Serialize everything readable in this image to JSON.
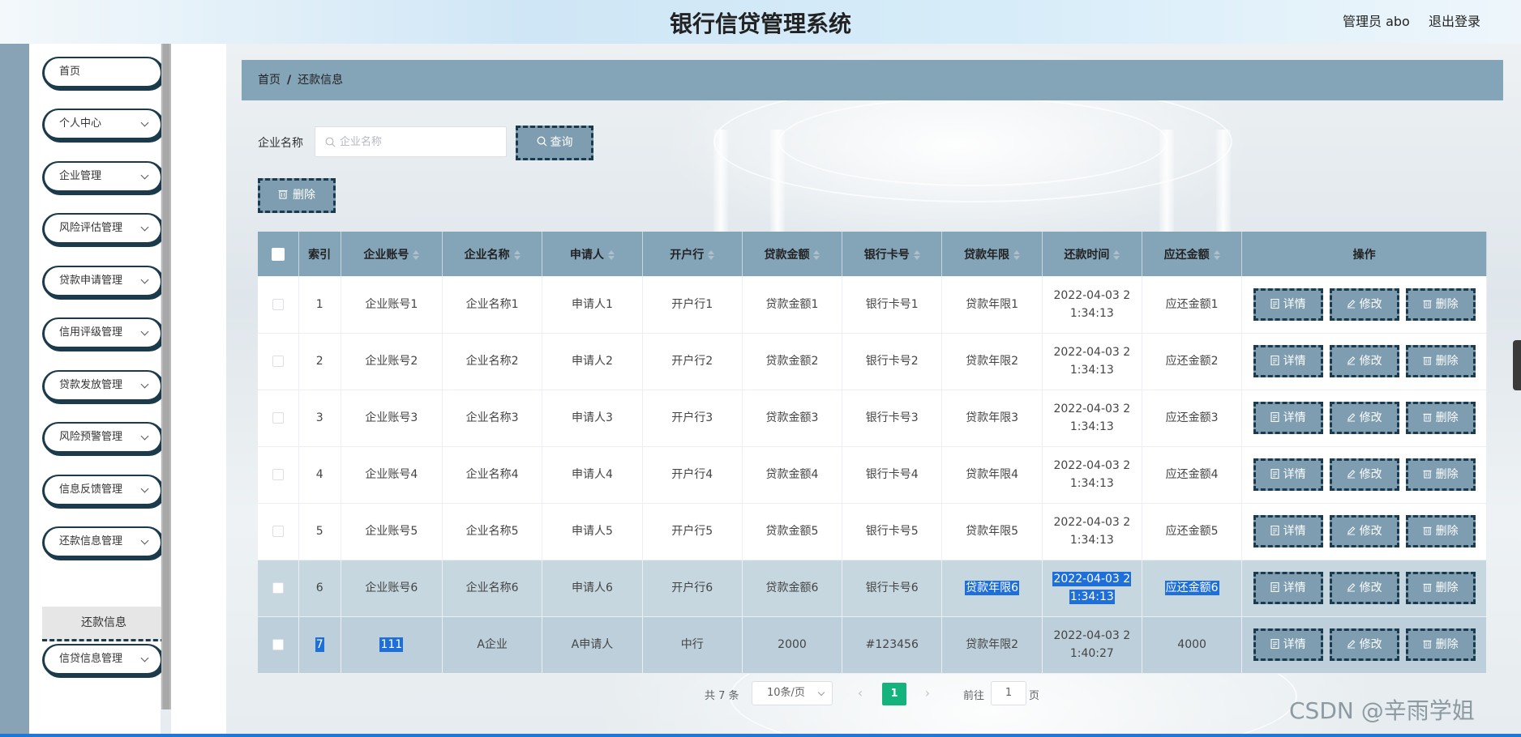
{
  "header": {
    "title": "银行信贷管理系统",
    "admin": "管理员 abo",
    "logout": "退出登录"
  },
  "sidebar": {
    "items": [
      {
        "label": "首页",
        "has_chevron": false
      },
      {
        "label": "个人中心",
        "has_chevron": true
      },
      {
        "label": "企业管理",
        "has_chevron": true
      },
      {
        "label": "风险评估管理",
        "has_chevron": true
      },
      {
        "label": "贷款申请管理",
        "has_chevron": true
      },
      {
        "label": "信用评级管理",
        "has_chevron": true
      },
      {
        "label": "贷款发放管理",
        "has_chevron": true
      },
      {
        "label": "风险预警管理",
        "has_chevron": true
      },
      {
        "label": "信息反馈管理",
        "has_chevron": true
      },
      {
        "label": "还款信息管理",
        "has_chevron": true
      },
      {
        "label": "信贷信息管理",
        "has_chevron": true
      }
    ],
    "active_sub": "还款信息"
  },
  "breadcrumb": {
    "home": "首页",
    "sep": "/",
    "current": "还款信息"
  },
  "search": {
    "label": "企业名称",
    "placeholder": "企业名称",
    "value": "",
    "query_button": "查询"
  },
  "toolbar": {
    "delete_button": "删除"
  },
  "table": {
    "columns": [
      "索引",
      "企业账号",
      "企业名称",
      "申请人",
      "开户行",
      "贷款金额",
      "银行卡号",
      "贷款年限",
      "还款时间",
      "应还金额",
      "操作"
    ],
    "rows": [
      {
        "idx": "1",
        "account": "企业账号1",
        "name": "企业名称1",
        "applicant": "申请人1",
        "bank": "开户行1",
        "amount": "贷款金额1",
        "card": "银行卡号1",
        "term": "贷款年限1",
        "time1": "2022-04-03 2",
        "time2": "1:34:13",
        "due": "应还金额1"
      },
      {
        "idx": "2",
        "account": "企业账号2",
        "name": "企业名称2",
        "applicant": "申请人2",
        "bank": "开户行2",
        "amount": "贷款金额2",
        "card": "银行卡号2",
        "term": "贷款年限2",
        "time1": "2022-04-03 2",
        "time2": "1:34:13",
        "due": "应还金额2"
      },
      {
        "idx": "3",
        "account": "企业账号3",
        "name": "企业名称3",
        "applicant": "申请人3",
        "bank": "开户行3",
        "amount": "贷款金额3",
        "card": "银行卡号3",
        "term": "贷款年限3",
        "time1": "2022-04-03 2",
        "time2": "1:34:13",
        "due": "应还金额3"
      },
      {
        "idx": "4",
        "account": "企业账号4",
        "name": "企业名称4",
        "applicant": "申请人4",
        "bank": "开户行4",
        "amount": "贷款金额4",
        "card": "银行卡号4",
        "term": "贷款年限4",
        "time1": "2022-04-03 2",
        "time2": "1:34:13",
        "due": "应还金额4"
      },
      {
        "idx": "5",
        "account": "企业账号5",
        "name": "企业名称5",
        "applicant": "申请人5",
        "bank": "开户行5",
        "amount": "贷款金额5",
        "card": "银行卡号5",
        "term": "贷款年限5",
        "time1": "2022-04-03 2",
        "time2": "1:34:13",
        "due": "应还金额5"
      },
      {
        "idx": "6",
        "account": "企业账号6",
        "name": "企业名称6",
        "applicant": "申请人6",
        "bank": "开户行6",
        "amount": "贷款金额6",
        "card": "银行卡号6",
        "term": "贷款年限6",
        "time1": "2022-04-03 2",
        "time2": "1:34:13",
        "due": "应还金额6"
      },
      {
        "idx": "7",
        "account": "111",
        "name": "A企业",
        "applicant": "A申请人",
        "bank": "中行",
        "amount": "2000",
        "card": "#123456",
        "term": "贷款年限2",
        "time1": "2022-04-03 2",
        "time2": "1:40:27",
        "due": "4000"
      }
    ],
    "actions": {
      "detail": "详情",
      "edit": "修改",
      "delete": "删除"
    }
  },
  "pagination": {
    "total": "共 7 条",
    "page_size": "10条/页",
    "current": "1",
    "goto_label": "前往",
    "goto_value": "1",
    "page_suffix": "页",
    "prev": "‹",
    "next": "›"
  },
  "watermark": "CSDN @辛雨学姐",
  "colors": {
    "accent": "#84a4b8",
    "button": "#7e9db0",
    "border": "#1b3a4b",
    "pager_active": "#14b27d",
    "selection": "#1e6fd9"
  }
}
